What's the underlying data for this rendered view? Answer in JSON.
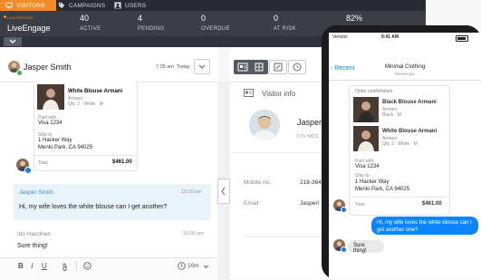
{
  "nav": {
    "tabs": [
      {
        "label": "VISITORS",
        "icon": "monitor-icon"
      },
      {
        "label": "CAMPAIGNS",
        "icon": "tag-icon"
      },
      {
        "label": "USERS",
        "icon": "person-icon"
      }
    ]
  },
  "brand": {
    "small": "LIVEPERSON",
    "name": "LiveEngage"
  },
  "stats": [
    {
      "value": "40",
      "label": "ACTIVE"
    },
    {
      "value": "4",
      "label": "PENDING"
    },
    {
      "value": "0",
      "label": "OVERDUE"
    },
    {
      "value": "0",
      "label": "AT RISK"
    },
    {
      "value": "82%",
      "label": ""
    }
  ],
  "chat": {
    "visitor_name": "Jasper Smith",
    "time": "7:28 am",
    "day": "Today",
    "order_card": {
      "product": "White Blouse Armani",
      "brand": "Armani",
      "qty": "Qty. 2 · White · M",
      "paid_label": "Paid with",
      "paid_value": "Visa 1234",
      "ship_label": "Ship to",
      "address1": "1 Hacker Way",
      "address2": "Menlo Park, CA 94025",
      "total_label": "Total",
      "total_value": "$461.00"
    },
    "messages": [
      {
        "sender": "Jasper Smith",
        "time": "10:00 am",
        "text": "Hi, my wife loves the white blouse can I get another?"
      },
      {
        "sender": "Ido Hacohen",
        "time": "10:00 am",
        "text": "Sure thing!"
      }
    ],
    "composer": {
      "timer": "10m"
    }
  },
  "visitor_info": {
    "title": "Visitor info",
    "name": "Jasper",
    "sub": "LTV MCS",
    "fields": [
      {
        "label": "Mobile no.:",
        "value": "218-364"
      },
      {
        "label": "Email:",
        "value": "Jasperi"
      }
    ]
  },
  "phone": {
    "carrier": "Verizon",
    "clock": "9:41 AM",
    "back": "Recent",
    "title": "Minimal Clothing",
    "subtitle": "Messenger",
    "order": {
      "header": "Order confirmation",
      "item1": {
        "name": "Black Blouse Armani",
        "brand": "Armani",
        "detail": "Black · M"
      },
      "item2": {
        "name": "White Blouse Armani",
        "brand": "Armani",
        "detail": "Qty. 2 · White · M"
      },
      "paid_label": "Paid with",
      "paid_value": "Visa 1234",
      "ship_label": "Ship to",
      "address1": "1 Hacker Way",
      "address2": "Menlo Park, CA 94025",
      "total_label": "Total",
      "total_value": "$461.00"
    },
    "outgoing": "Hi, my wife loves the white blouse can I get another one?",
    "incoming": "Sure thing!"
  },
  "colors": {
    "accent": "#f28c28",
    "nav_bg": "#272c33",
    "ios_blue": "#0b84ff"
  }
}
